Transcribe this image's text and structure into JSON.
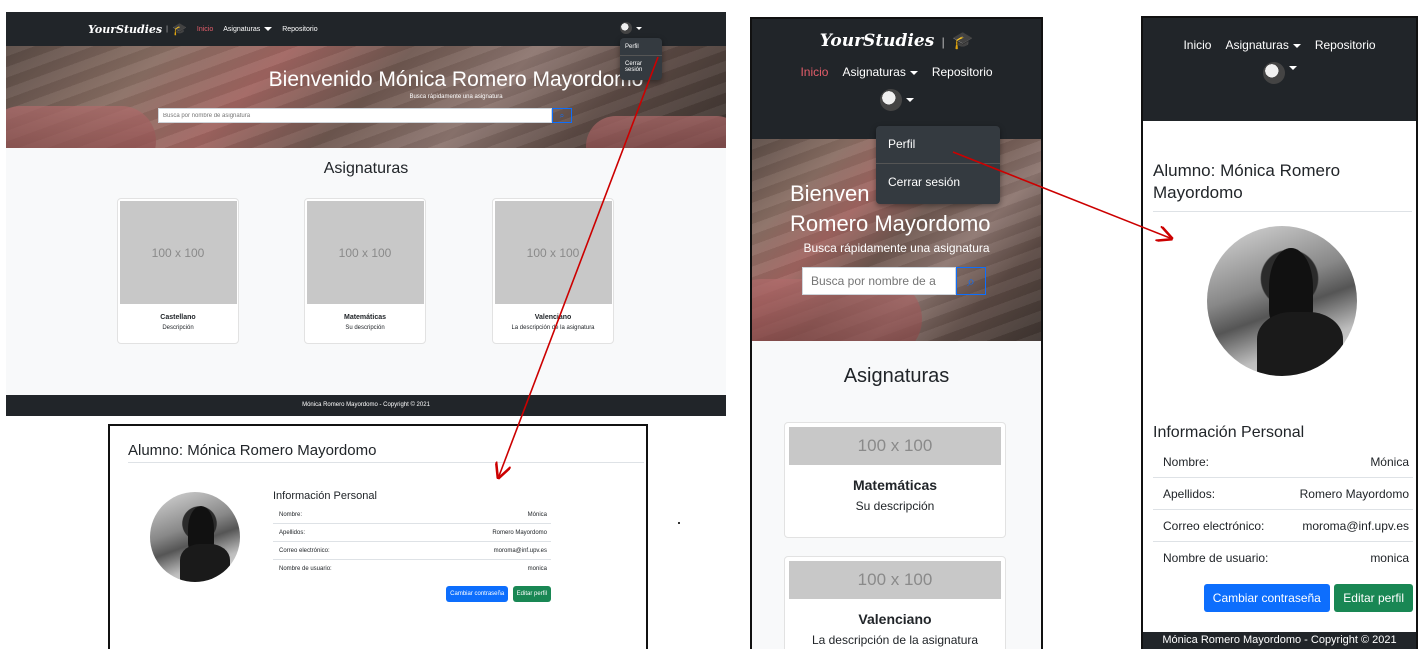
{
  "brand": "YourStudies",
  "nav": {
    "home": "Inicio",
    "subjects": "Asignaturas",
    "repository": "Repositorio"
  },
  "user_menu": {
    "profile": "Perfil",
    "logout": "Cerrar sesión"
  },
  "hero": {
    "title": "Bienvenido Mónica Romero Mayordomo",
    "subtitle": "Busca rápidamente una asignatura",
    "search_placeholder": "Busca por nombre de asignatura",
    "mobile_title_visible": "Bienven",
    "mobile_title_line2": "Romero Mayordomo",
    "mobile_search_placeholder": "Busca por nombre de a"
  },
  "subjects_title": "Asignaturas",
  "placeholder_label": "100 x 100",
  "cards": [
    {
      "title": "Castellano",
      "description": "Descripción"
    },
    {
      "title": "Matemáticas",
      "description": "Su descripción"
    },
    {
      "title": "Valenciano",
      "description": "La descripción de la asignatura"
    }
  ],
  "footer": "Mónica Romero Mayordomo - Copyright © 2021",
  "profile": {
    "title": "Alumno: Mónica Romero Mayordomo",
    "title_mobile_line1": "Alumno: Mónica Romero",
    "title_mobile_line2": "Mayordomo",
    "info_heading": "Información Personal",
    "fields": [
      {
        "label": "Nombre:",
        "value": "Mónica"
      },
      {
        "label": "Apellidos:",
        "value": "Romero Mayordomo"
      },
      {
        "label": "Correo electrónico:",
        "value": "moroma@inf.upv.es"
      },
      {
        "label": "Nombre de usuario:",
        "value": "monica"
      }
    ],
    "change_password": "Cambiar contraseña",
    "edit_profile": "Editar perfil"
  },
  "colors": {
    "navbar": "#212529",
    "active_link": "#e35d6a",
    "primary": "#0d6efd",
    "success": "#198754",
    "arrow": "#cc0000"
  }
}
